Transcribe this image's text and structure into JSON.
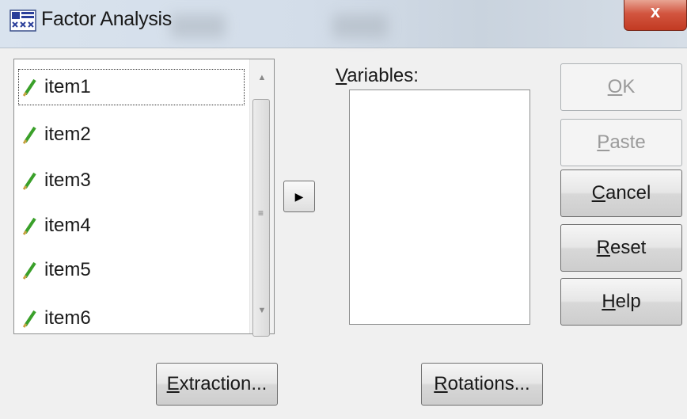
{
  "window": {
    "title": "Factor Analysis",
    "close_label": "x"
  },
  "source_list": {
    "items": [
      {
        "label": "item1"
      },
      {
        "label": "item2"
      },
      {
        "label": "item3"
      },
      {
        "label": "item4"
      },
      {
        "label": "item5"
      },
      {
        "label": "item6"
      }
    ]
  },
  "variables": {
    "label_mnemonic": "V",
    "label_rest": "ariables:"
  },
  "side_buttons": {
    "ok": {
      "mn": "O",
      "rest": "K"
    },
    "paste": {
      "mn": "P",
      "rest": "aste"
    },
    "cancel": {
      "mn": "C",
      "rest": "ancel"
    },
    "reset": {
      "mn": "R",
      "rest": "eset"
    },
    "help": {
      "mn": "H",
      "rest": "elp"
    }
  },
  "bottom_buttons": {
    "extraction": {
      "mn": "E",
      "rest": "xtraction..."
    },
    "rotations": {
      "mn": "R",
      "rest": "otations..."
    }
  },
  "colors": {
    "pencil_green": "#3aa02a",
    "pencil_tip": "#c8a040",
    "close_red": "#c23a22"
  }
}
